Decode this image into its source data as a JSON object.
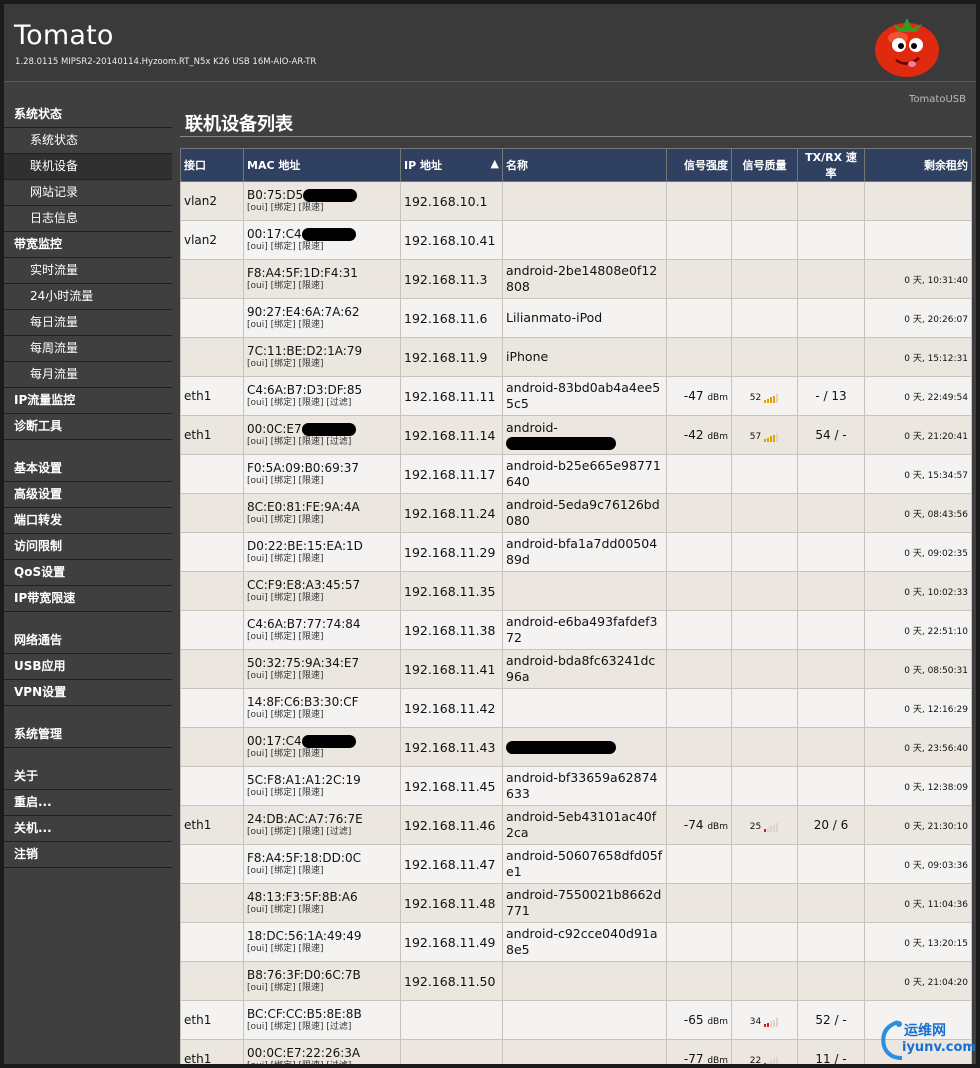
{
  "header": {
    "title": "Tomato",
    "version": "1.28.0115 MIPSR2-20140114.Hyzoom.RT_N5x K26 USB 16M-AIO-AR-TR",
    "corner_label": "TomatoUSB"
  },
  "sidebar": {
    "items": [
      {
        "label": "系统状态",
        "type": "section"
      },
      {
        "label": "系统状态",
        "type": "sub"
      },
      {
        "label": "联机设备",
        "type": "sub",
        "active": true
      },
      {
        "label": "网站记录",
        "type": "sub"
      },
      {
        "label": "日志信息",
        "type": "sub"
      },
      {
        "label": "带宽监控",
        "type": "section"
      },
      {
        "label": "实时流量",
        "type": "sub"
      },
      {
        "label": "24小时流量",
        "type": "sub"
      },
      {
        "label": "每日流量",
        "type": "sub"
      },
      {
        "label": "每周流量",
        "type": "sub"
      },
      {
        "label": "每月流量",
        "type": "sub"
      },
      {
        "label": "IP流量监控",
        "type": "section"
      },
      {
        "label": "诊断工具",
        "type": "section"
      },
      {
        "type": "gap"
      },
      {
        "label": "基本设置",
        "type": "section"
      },
      {
        "label": "高级设置",
        "type": "section"
      },
      {
        "label": "端口转发",
        "type": "section"
      },
      {
        "label": "访问限制",
        "type": "section"
      },
      {
        "label": "QoS设置",
        "type": "section"
      },
      {
        "label": "IP带宽限速",
        "type": "section"
      },
      {
        "type": "gap"
      },
      {
        "label": "网络通告",
        "type": "section"
      },
      {
        "label": "USB应用",
        "type": "section"
      },
      {
        "label": "VPN设置",
        "type": "section"
      },
      {
        "type": "gap"
      },
      {
        "label": "系统管理",
        "type": "section"
      },
      {
        "type": "gap"
      },
      {
        "label": "关于",
        "type": "section"
      },
      {
        "label": "重启...",
        "type": "section"
      },
      {
        "label": "关机...",
        "type": "section"
      },
      {
        "label": "注销",
        "type": "section"
      }
    ]
  },
  "page": {
    "title": "联机设备列表"
  },
  "table": {
    "columns": [
      "接口",
      "MAC 地址",
      "IP 地址",
      "名称",
      "信号强度",
      "信号质量",
      "TX/RX 速率",
      "剩余租约"
    ],
    "sort_indicator": "▲",
    "link_labels": {
      "oui": "[oui]",
      "bind": "[绑定]",
      "limit": "[限速]",
      "filter": "[过滤]"
    },
    "signal_unit": "dBm",
    "rows": [
      {
        "iface": "vlan2",
        "mac": "B0:75:D5",
        "mac_redacted": true,
        "ip": "192.168.10.1",
        "name": "",
        "rssi": "",
        "quality": "",
        "rate": "",
        "lease": "",
        "filter": false
      },
      {
        "iface": "vlan2",
        "mac": "00:17:C4",
        "mac_redacted": true,
        "ip": "192.168.10.41",
        "name": "",
        "rssi": "",
        "quality": "",
        "rate": "",
        "lease": "",
        "filter": false
      },
      {
        "iface": "",
        "mac": "F8:A4:5F:1D:F4:31",
        "ip": "192.168.11.3",
        "name": "android-2be14808e0f12808",
        "rssi": "",
        "quality": "",
        "rate": "",
        "lease": "0 天, 10:31:40",
        "filter": false
      },
      {
        "iface": "",
        "mac": "90:27:E4:6A:7A:62",
        "ip": "192.168.11.6",
        "name": "Lilianmato-iPod",
        "rssi": "",
        "quality": "",
        "rate": "",
        "lease": "0 天, 20:26:07",
        "filter": false
      },
      {
        "iface": "",
        "mac": "7C:11:BE:D2:1A:79",
        "ip": "192.168.11.9",
        "name": "iPhone",
        "rssi": "",
        "quality": "",
        "rate": "",
        "lease": "0 天, 15:12:31",
        "filter": false
      },
      {
        "iface": "eth1",
        "mac": "C4:6A:B7:D3:DF:85",
        "ip": "192.168.11.11",
        "name": "android-83bd0ab4a4ee55c5",
        "rssi": "-47",
        "quality": "52",
        "quality_level": 4,
        "rate": "- / 13",
        "lease": "0 天, 22:49:54",
        "filter": true
      },
      {
        "iface": "eth1",
        "mac": "00:0C:E7",
        "mac_redacted": true,
        "ip": "192.168.11.14",
        "name": "android-",
        "name_redacted": true,
        "rssi": "-42",
        "quality": "57",
        "quality_level": 4,
        "rate": "54 / -",
        "lease": "0 天, 21:20:41",
        "filter": true
      },
      {
        "iface": "",
        "mac": "F0:5A:09:B0:69:37",
        "ip": "192.168.11.17",
        "name": "android-b25e665e98771640",
        "rssi": "",
        "quality": "",
        "rate": "",
        "lease": "0 天, 15:34:57",
        "filter": false
      },
      {
        "iface": "",
        "mac": "8C:E0:81:FE:9A:4A",
        "ip": "192.168.11.24",
        "name": "android-5eda9c76126bd080",
        "rssi": "",
        "quality": "",
        "rate": "",
        "lease": "0 天, 08:43:56",
        "filter": false
      },
      {
        "iface": "",
        "mac": "D0:22:BE:15:EA:1D",
        "ip": "192.168.11.29",
        "name": "android-bfa1a7dd0050489d",
        "rssi": "",
        "quality": "",
        "rate": "",
        "lease": "0 天, 09:02:35",
        "filter": false
      },
      {
        "iface": "",
        "mac": "CC:F9:E8:A3:45:57",
        "ip": "192.168.11.35",
        "name": "",
        "rssi": "",
        "quality": "",
        "rate": "",
        "lease": "0 天, 10:02:33",
        "filter": false
      },
      {
        "iface": "",
        "mac": "C4:6A:B7:77:74:84",
        "ip": "192.168.11.38",
        "name": "android-e6ba493fafdef372",
        "rssi": "",
        "quality": "",
        "rate": "",
        "lease": "0 天, 22:51:10",
        "filter": false
      },
      {
        "iface": "",
        "mac": "50:32:75:9A:34:E7",
        "ip": "192.168.11.41",
        "name": "android-bda8fc63241dc96a",
        "rssi": "",
        "quality": "",
        "rate": "",
        "lease": "0 天, 08:50:31",
        "filter": false
      },
      {
        "iface": "",
        "mac": "14:8F:C6:B3:30:CF",
        "ip": "192.168.11.42",
        "name": "",
        "rssi": "",
        "quality": "",
        "rate": "",
        "lease": "0 天, 12:16:29",
        "filter": false
      },
      {
        "iface": "",
        "mac": "00:17:C4",
        "mac_redacted": true,
        "ip": "192.168.11.43",
        "name": "",
        "name_redacted": true,
        "rssi": "",
        "quality": "",
        "rate": "",
        "lease": "0 天, 23:56:40",
        "filter": false
      },
      {
        "iface": "",
        "mac": "5C:F8:A1:A1:2C:19",
        "ip": "192.168.11.45",
        "name": "android-bf33659a62874633",
        "rssi": "",
        "quality": "",
        "rate": "",
        "lease": "0 天, 12:38:09",
        "filter": false
      },
      {
        "iface": "eth1",
        "mac": "24:DB:AC:A7:76:7E",
        "ip": "192.168.11.46",
        "name": "android-5eb43101ac40f2ca",
        "rssi": "-74",
        "quality": "25",
        "quality_level": 1,
        "rate": "20 / 6",
        "lease": "0 天, 21:30:10",
        "filter": true
      },
      {
        "iface": "",
        "mac": "F8:A4:5F:18:DD:0C",
        "ip": "192.168.11.47",
        "name": "android-50607658dfd05fe1",
        "rssi": "",
        "quality": "",
        "rate": "",
        "lease": "0 天, 09:03:36",
        "filter": false
      },
      {
        "iface": "",
        "mac": "48:13:F3:5F:8B:A6",
        "ip": "192.168.11.48",
        "name": "android-7550021b8662d771",
        "rssi": "",
        "quality": "",
        "rate": "",
        "lease": "0 天, 11:04:36",
        "filter": false
      },
      {
        "iface": "",
        "mac": "18:DC:56:1A:49:49",
        "ip": "192.168.11.49",
        "name": "android-c92cce040d91a8e5",
        "rssi": "",
        "quality": "",
        "rate": "",
        "lease": "0 天, 13:20:15",
        "filter": false
      },
      {
        "iface": "",
        "mac": "B8:76:3F:D0:6C:7B",
        "ip": "192.168.11.50",
        "name": "",
        "rssi": "",
        "quality": "",
        "rate": "",
        "lease": "0 天, 21:04:20",
        "filter": false
      },
      {
        "iface": "eth1",
        "mac": "BC:CF:CC:B5:8E:8B",
        "ip": "",
        "name": "",
        "rssi": "-65",
        "quality": "34",
        "quality_level": 2,
        "rate": "52 / -",
        "lease": "",
        "filter": true
      },
      {
        "iface": "eth1",
        "mac": "00:0C:E7:22:26:3A",
        "ip": "",
        "name": "",
        "rssi": "-77",
        "quality": "22",
        "quality_level": 1,
        "rate": "11 / -",
        "lease": "",
        "filter": true
      }
    ]
  },
  "watermark": {
    "line1": "运维网",
    "line2": "iyunv.com"
  },
  "colors": {
    "header_bg": "#3a3a3a",
    "table_header": "#304060",
    "row_odd": "#ebe6e0",
    "row_even": "#f5f3f1",
    "quality_high": "#e8a000",
    "quality_low": "#d02020"
  }
}
